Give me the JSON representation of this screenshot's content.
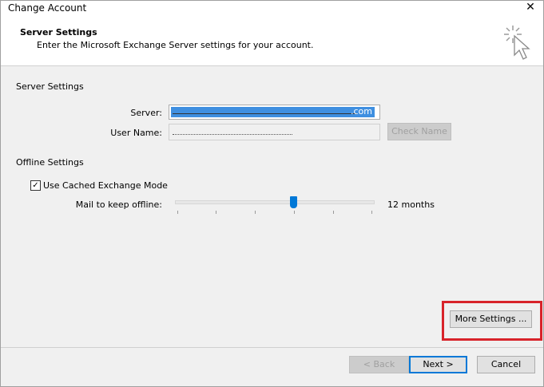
{
  "window": {
    "title": "Change Account",
    "close_glyph": "✕"
  },
  "header": {
    "title": "Server Settings",
    "subtitle": "Enter the Microsoft Exchange Server settings for your account."
  },
  "server_section": {
    "label": "Server Settings",
    "server_label": "Server:",
    "server_value_suffix": ".com",
    "username_label": "User Name:",
    "check_name_button": "Check Name"
  },
  "offline_section": {
    "label": "Offline Settings",
    "cached_mode_label": "Use Cached Exchange Mode",
    "cached_mode_checked": true,
    "checkmark_glyph": "✓",
    "mail_offline_label": "Mail to keep offline:",
    "mail_offline_value": "12 months",
    "slider_fraction": 0.6
  },
  "buttons": {
    "more_settings": "More Settings ...",
    "back": "< Back",
    "next": "Next >",
    "cancel": "Cancel"
  },
  "colors": {
    "accent": "#0078d7",
    "highlight": "#d8232a"
  }
}
